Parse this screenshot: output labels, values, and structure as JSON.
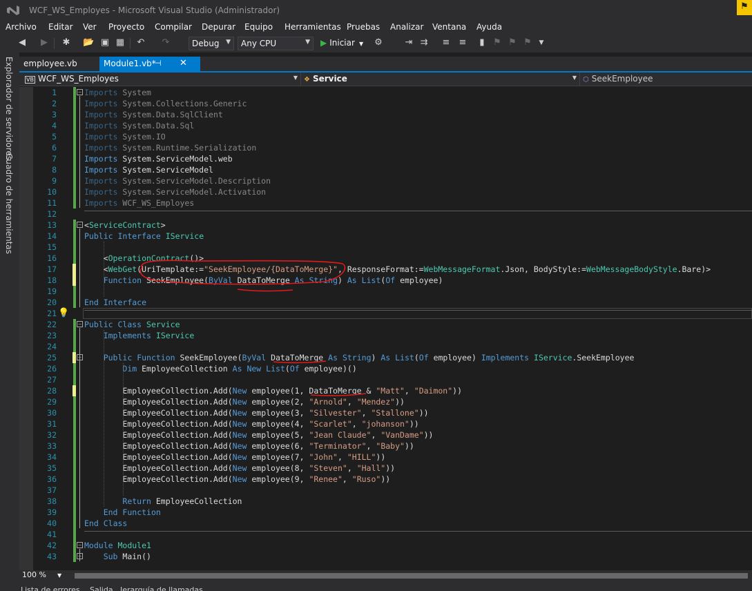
{
  "window": {
    "title": "WCF_WS_Employes - Microsoft Visual Studio (Administrador)"
  },
  "menu": [
    "Archivo",
    "Editar",
    "Ver",
    "Proyecto",
    "Compilar",
    "Depurar",
    "Equipo",
    "Herramientas",
    "Pruebas",
    "Analizar",
    "Ventana",
    "Ayuda"
  ],
  "toolbar": {
    "config": "Debug",
    "platform": "Any CPU",
    "start_label": "Iniciar"
  },
  "side_tabs": [
    "Explorador de servidores",
    "Cuadro de herramientas"
  ],
  "tabs": [
    {
      "label": "employee.vb",
      "active": false
    },
    {
      "label": "Module1.vb*",
      "active": true
    }
  ],
  "navbar": {
    "project": "WCF_WS_Employes",
    "type": "Service",
    "member": "SeekEmployee"
  },
  "editor": {
    "zoom": "100 %",
    "lines": [
      {
        "n": "1",
        "text": "Imports System"
      },
      {
        "n": "2",
        "text": "Imports System.Collections.Generic"
      },
      {
        "n": "3",
        "text": "Imports System.Data.SqlClient"
      },
      {
        "n": "4",
        "text": "Imports System.Data.Sql"
      },
      {
        "n": "5",
        "text": "Imports System.IO"
      },
      {
        "n": "6",
        "text": "Imports System.Runtime.Serialization"
      },
      {
        "n": "7",
        "text": "Imports System.ServiceModel.web"
      },
      {
        "n": "8",
        "text": "Imports System.ServiceModel"
      },
      {
        "n": "9",
        "text": "Imports System.ServiceModel.Description"
      },
      {
        "n": "10",
        "text": "Imports System.ServiceModel.Activation"
      },
      {
        "n": "11",
        "text": "Imports WCF_WS_Employes"
      },
      {
        "n": "12",
        "text": ""
      },
      {
        "n": "13",
        "text": "<ServiceContract>"
      },
      {
        "n": "14",
        "text": "Public Interface IService"
      },
      {
        "n": "15",
        "text": ""
      },
      {
        "n": "16",
        "text": "    <OperationContract()>"
      },
      {
        "n": "17",
        "text": "    <WebGet(UriTemplate:=\"SeekEmployee/{DataToMerge}\", ResponseFormat:=WebMessageFormat.Json, BodyStyle:=WebMessageBodyStyle.Bare)>"
      },
      {
        "n": "18",
        "text": "    Function SeekEmployee(ByVal DataToMerge As String) As List(Of employee)"
      },
      {
        "n": "19",
        "text": ""
      },
      {
        "n": "20",
        "text": "End Interface"
      },
      {
        "n": "21",
        "text": ""
      },
      {
        "n": "22",
        "text": "Public Class Service"
      },
      {
        "n": "23",
        "text": "    Implements IService"
      },
      {
        "n": "24",
        "text": ""
      },
      {
        "n": "25",
        "text": "    Public Function SeekEmployee(ByVal DataToMerge As String) As List(Of employee) Implements IService.SeekEmployee"
      },
      {
        "n": "26",
        "text": "        Dim EmployeeCollection As New List(Of employee)()"
      },
      {
        "n": "27",
        "text": ""
      },
      {
        "n": "28",
        "text": "        EmployeeCollection.Add(New employee(1, DataToMerge & \"Matt\", \"Daimon\"))"
      },
      {
        "n": "29",
        "text": "        EmployeeCollection.Add(New employee(2, \"Arnold\", \"Mendez\"))"
      },
      {
        "n": "30",
        "text": "        EmployeeCollection.Add(New employee(3, \"Silvester\", \"Stallone\"))"
      },
      {
        "n": "31",
        "text": "        EmployeeCollection.Add(New employee(4, \"Scarlet\", \"johanson\"))"
      },
      {
        "n": "32",
        "text": "        EmployeeCollection.Add(New employee(5, \"Jean Claude\", \"VanDame\"))"
      },
      {
        "n": "33",
        "text": "        EmployeeCollection.Add(New employee(6, \"Terminator\", \"Baby\"))"
      },
      {
        "n": "34",
        "text": "        EmployeeCollection.Add(New employee(7, \"John\", \"HILL\"))"
      },
      {
        "n": "35",
        "text": "        EmployeeCollection.Add(New employee(8, \"Steven\", \"Hall\"))"
      },
      {
        "n": "36",
        "text": "        EmployeeCollection.Add(New employee(9, \"Renee\", \"Ruso\"))"
      },
      {
        "n": "37",
        "text": ""
      },
      {
        "n": "38",
        "text": "        Return EmployeeCollection"
      },
      {
        "n": "39",
        "text": "    End Function"
      },
      {
        "n": "40",
        "text": "End Class"
      },
      {
        "n": "41",
        "text": ""
      },
      {
        "n": "42",
        "text": "Module Module1"
      },
      {
        "n": "43",
        "text": "    Sub Main()"
      }
    ]
  },
  "bottom_tabs": [
    "Lista de errores",
    "Salida",
    "Jerarquía de llamadas"
  ],
  "colors": {
    "accent": "#007acc",
    "keyword": "#569cd6",
    "type": "#4ec9b0",
    "string": "#d69d85",
    "line_number": "#2b91af",
    "annotation": "#e01b1b"
  }
}
